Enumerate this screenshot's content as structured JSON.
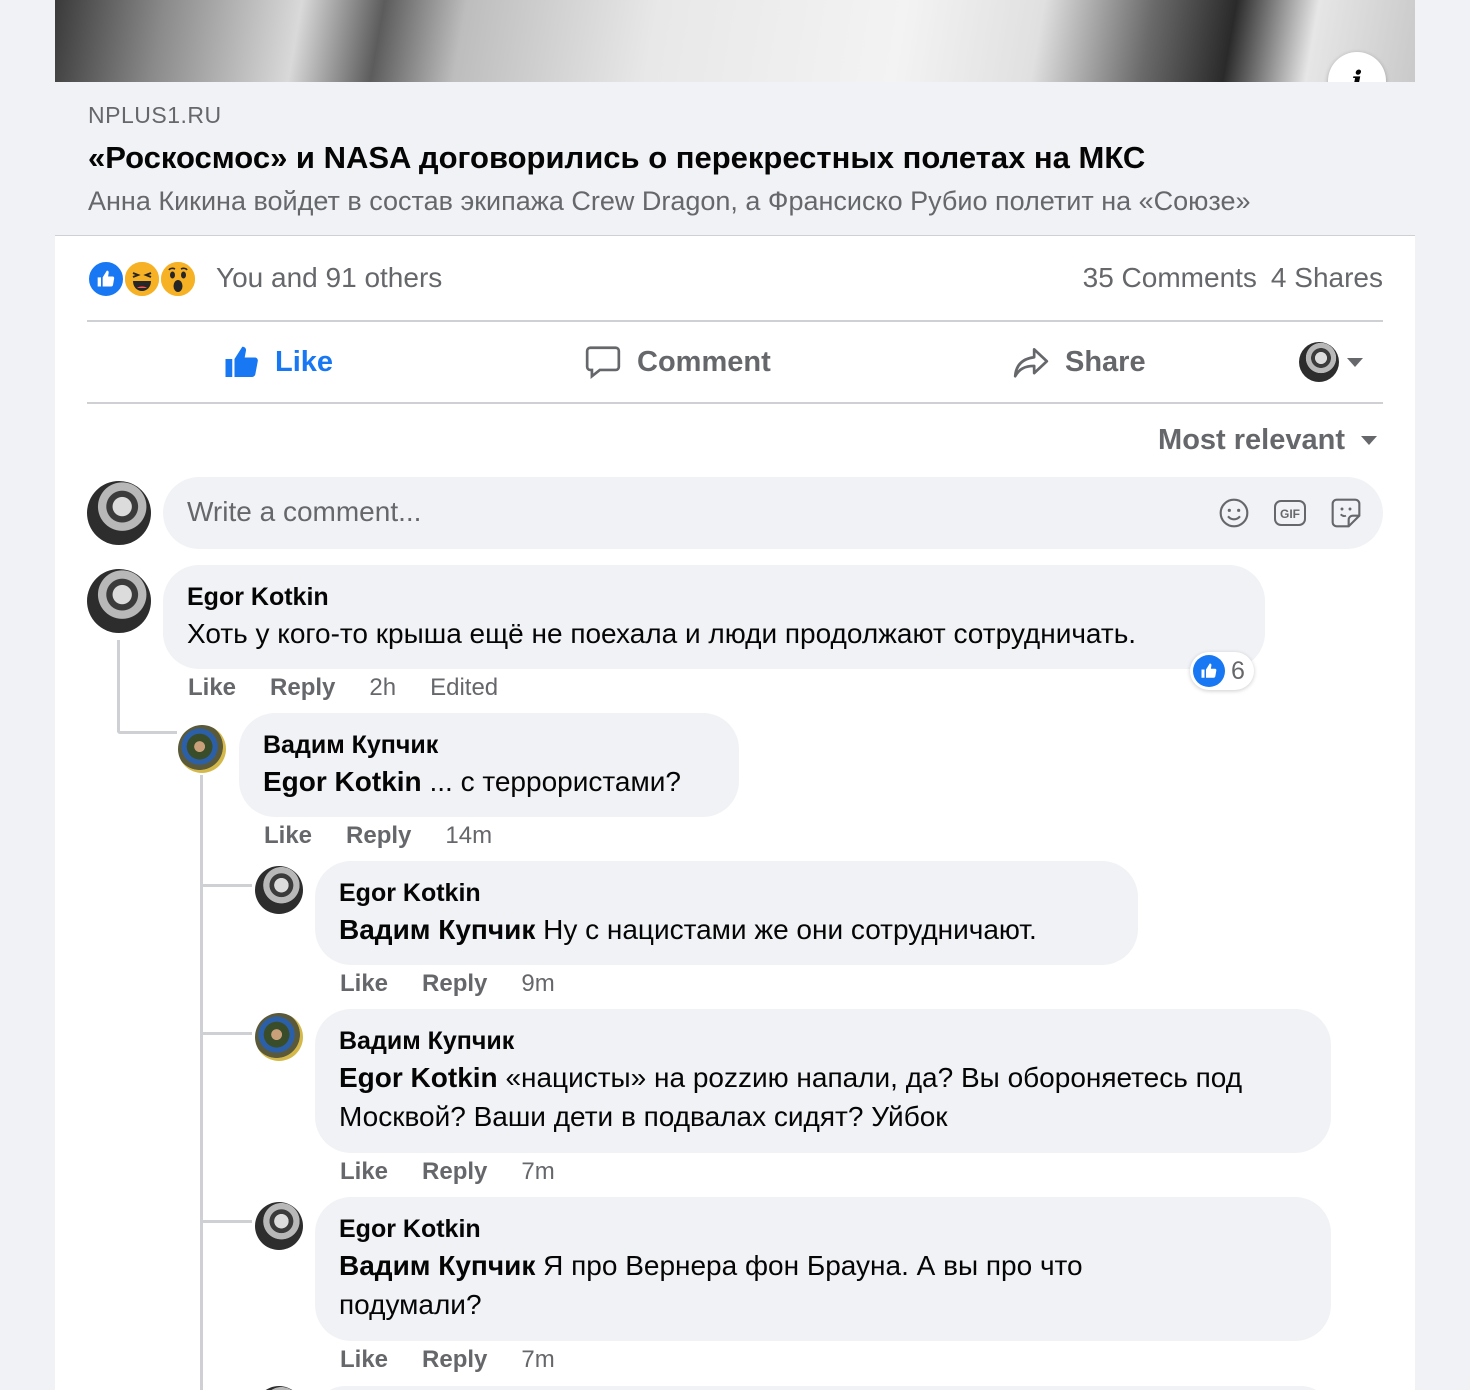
{
  "link": {
    "domain": "NPLUS1.RU",
    "title": "«Роскосмос» и NASA договорились о перекрестных полетах на МКС",
    "description": "Анна Кикина войдет в состав экипажа Crew Dragon, а Франсиско Рубио полетит на «Союзе»"
  },
  "stats": {
    "reactions_text": "You and 91 others",
    "comments": "35 Comments",
    "shares": "4 Shares",
    "reaction_icons": [
      "like-icon",
      "haha-icon",
      "wow-icon"
    ]
  },
  "actions": {
    "like": "Like",
    "comment": "Comment",
    "share": "Share"
  },
  "sort": {
    "label": "Most relevant"
  },
  "composer": {
    "placeholder": "Write a comment..."
  },
  "comments": [
    {
      "author": "Egor Kotkin",
      "text": "Хоть у кого-то крыша ещё не поехала и люди продолжают сотрудничать.",
      "like": "Like",
      "reply": "Reply",
      "time": "2h",
      "edited": "Edited",
      "reaction_count": "6"
    },
    {
      "author": "Вадим Купчик",
      "mention": "Egor Kotkin",
      "text": " ... с террористами?",
      "like": "Like",
      "reply": "Reply",
      "time": "14m"
    },
    {
      "author": "Egor Kotkin",
      "mention": "Вадим Купчик",
      "text": " Ну с нацистами же они сотрудничают.",
      "like": "Like",
      "reply": "Reply",
      "time": "9m"
    },
    {
      "author": "Вадим Купчик",
      "mention": "Egor Kotkin",
      "text": " «нацисты» на pozzию напали, да? Вы обороняетесь под Москвой? Ваши дети в подвалах сидят? Уйбок",
      "like": "Like",
      "reply": "Reply",
      "time": "7m"
    },
    {
      "author": "Egor Kotkin",
      "mention": "Вадим Купчик",
      "text": " Я про Вернера фон Брауна. А вы про что подумали?",
      "like": "Like",
      "reply": "Reply",
      "time": "7m"
    }
  ],
  "colors": {
    "accent": "#1877f2",
    "secondary_text": "#65676b",
    "bubble": "#f0f2f5"
  }
}
